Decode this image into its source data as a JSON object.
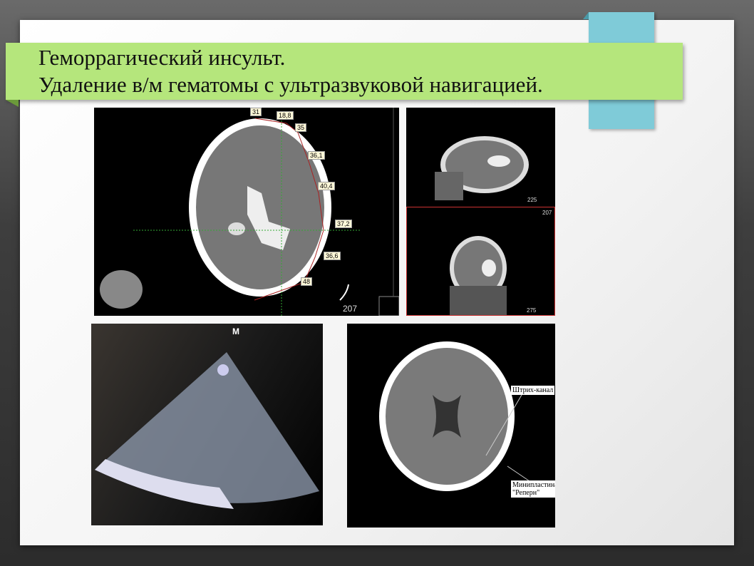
{
  "slide": {
    "title_line1": "Геморрагический инсульт.",
    "title_line2": "Удаление в/м гематомы с ультразвуковой навигацией."
  },
  "ct_axial": {
    "measurements": [
      "31",
      "18,8",
      "35",
      "36,1",
      "40,4",
      "37,2",
      "36,6",
      "48"
    ],
    "slice_number": "207"
  },
  "ct_sagittal": {
    "slice_number": "225"
  },
  "ct_coronal": {
    "top_number": "207",
    "slice_number": "275"
  },
  "ultrasound": {
    "marker": "M"
  },
  "ct_postop": {
    "label_channel": "Штрих-канал",
    "label_plate_line1": "Минипластина",
    "label_plate_line2": "\"Реперн\""
  }
}
